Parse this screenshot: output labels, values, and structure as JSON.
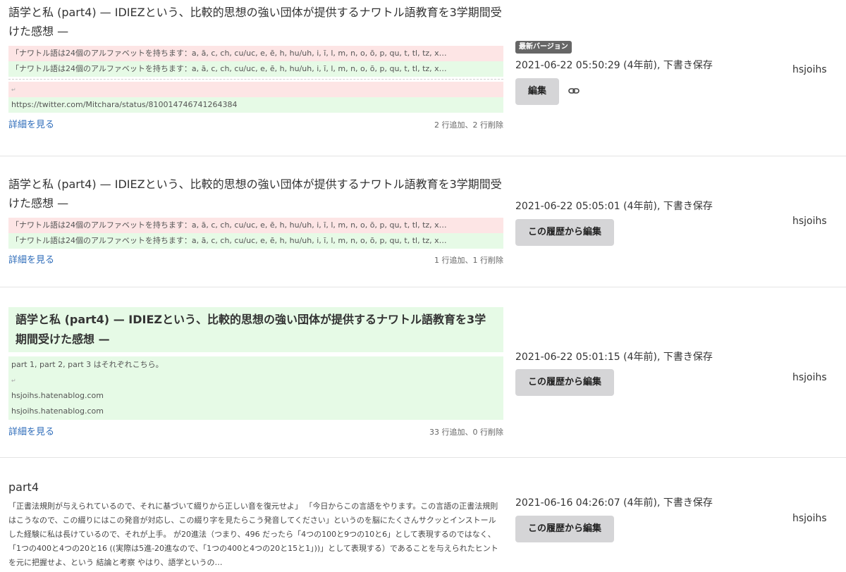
{
  "revisions": [
    {
      "title": "語学と私 (part4) — IDIEZという、比較的思想の強い団体が提供するナワトル語教育を3学期間受けた感想 —",
      "diff": {
        "del1": "「ナワトル語は24個のアルファベットを持ちます：a, ā, c, ch, cu/uc, e, ē, h, hu/uh, i, ī, l, m, n, o, ō, p, qu, t, tl, tz, x…",
        "add1": "「ナワトル語は24個のアルファベットを持ちます：a, ā, c, ch, cu/uc, e, ē, h, hu/uh, i, ī, l, m, n, o, ō, p, qu, t, tl, tz, x…",
        "del2": "↵",
        "add2": "https://twitter.com/Mitchara/status/810014746741264384"
      },
      "detail_label": "詳細を見る",
      "stats": "2 行追加、2 行削除",
      "badge": "最新バージョン",
      "timestamp": "2021-06-22 05:50:29 (4年前), 下書き保存",
      "button": "編集",
      "user": "hsjoihs"
    },
    {
      "title": "語学と私 (part4) — IDIEZという、比較的思想の強い団体が提供するナワトル語教育を3学期間受けた感想 —",
      "diff": {
        "del1": "「ナワトル語は24個のアルファベットを持ちます：a, ā, c, ch, cu/uc, e, ē, h, hu/uh, i, ī, l, m, n, o, ō, p, qu, t, tl, tz, x…",
        "add1": "「ナワトル語は24個のアルファベットを持ちます：a, ā, c, ch, cu/uc, e, ē, h, hu/uh, i, ī, l, m, n, o, ō, p, qu, t, tl, tz, x…"
      },
      "detail_label": "詳細を見る",
      "stats": "1 行追加、1 行削除",
      "timestamp": "2021-06-22 05:05:01 (4年前), 下書き保存",
      "button": "この履歴から編集",
      "user": "hsjoihs"
    },
    {
      "title": "語学と私 (part4) — IDIEZという、比較的思想の強い団体が提供するナワトル語教育を3学期間受けた感想 —",
      "lines": [
        "part 1, part 2, part 3 はそれぞれこちら。",
        "↵",
        "hsjoihs.hatenablog.com",
        "hsjoihs.hatenablog.com"
      ],
      "detail_label": "詳細を見る",
      "stats": "33 行追加、0 行削除",
      "timestamp": "2021-06-22 05:01:15 (4年前), 下書き保存",
      "button": "この履歴から編集",
      "user": "hsjoihs"
    },
    {
      "title": "part4",
      "excerpt": "「正書法規則が与えられているので、それに基づいて綴りから正しい音を復元せよ」 「今日からこの言語をやります。この言語の正書法規則はこうなので、この綴りにはこの発音が対応し、この綴り字を見たらこう発音してください」というのを脳にたくさんサクッとインストールした経験に私は長けているので、それが上手。 が20進法（つまり、496 だったら「4つの100と9つの10と6」として表現するのではなく、「1つの400と4つの20と16 ((実際は5進-20進なので、「1つの400と4つの20と15と1」))」として表現する）であることを与えられたヒントを元に把握せよ、という 結論と考察 やはり、語学というの…",
      "timestamp": "2021-06-16 04:26:07 (4年前), 下書き保存",
      "button": "この履歴から編集",
      "user": "hsjoihs"
    }
  ],
  "icons": {
    "permalink": "link-icon"
  }
}
